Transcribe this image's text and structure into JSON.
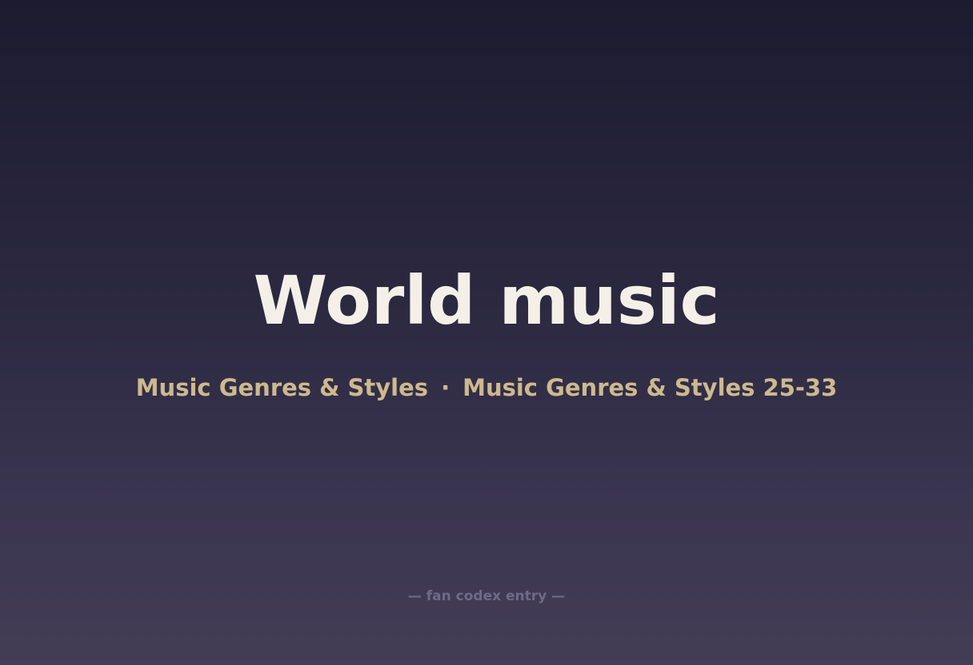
{
  "title": "World music",
  "subtitle": {
    "left": "Music Genres & Styles",
    "separator": "·",
    "right": "Music Genres & Styles 25-33"
  },
  "footer": "— fan codex entry —",
  "colors": {
    "background_top": "#1d1b30",
    "background_bottom": "#433d55",
    "title": "#f4f0e8",
    "subtitle": "#cdb98e",
    "footer": "#6f6a86"
  }
}
